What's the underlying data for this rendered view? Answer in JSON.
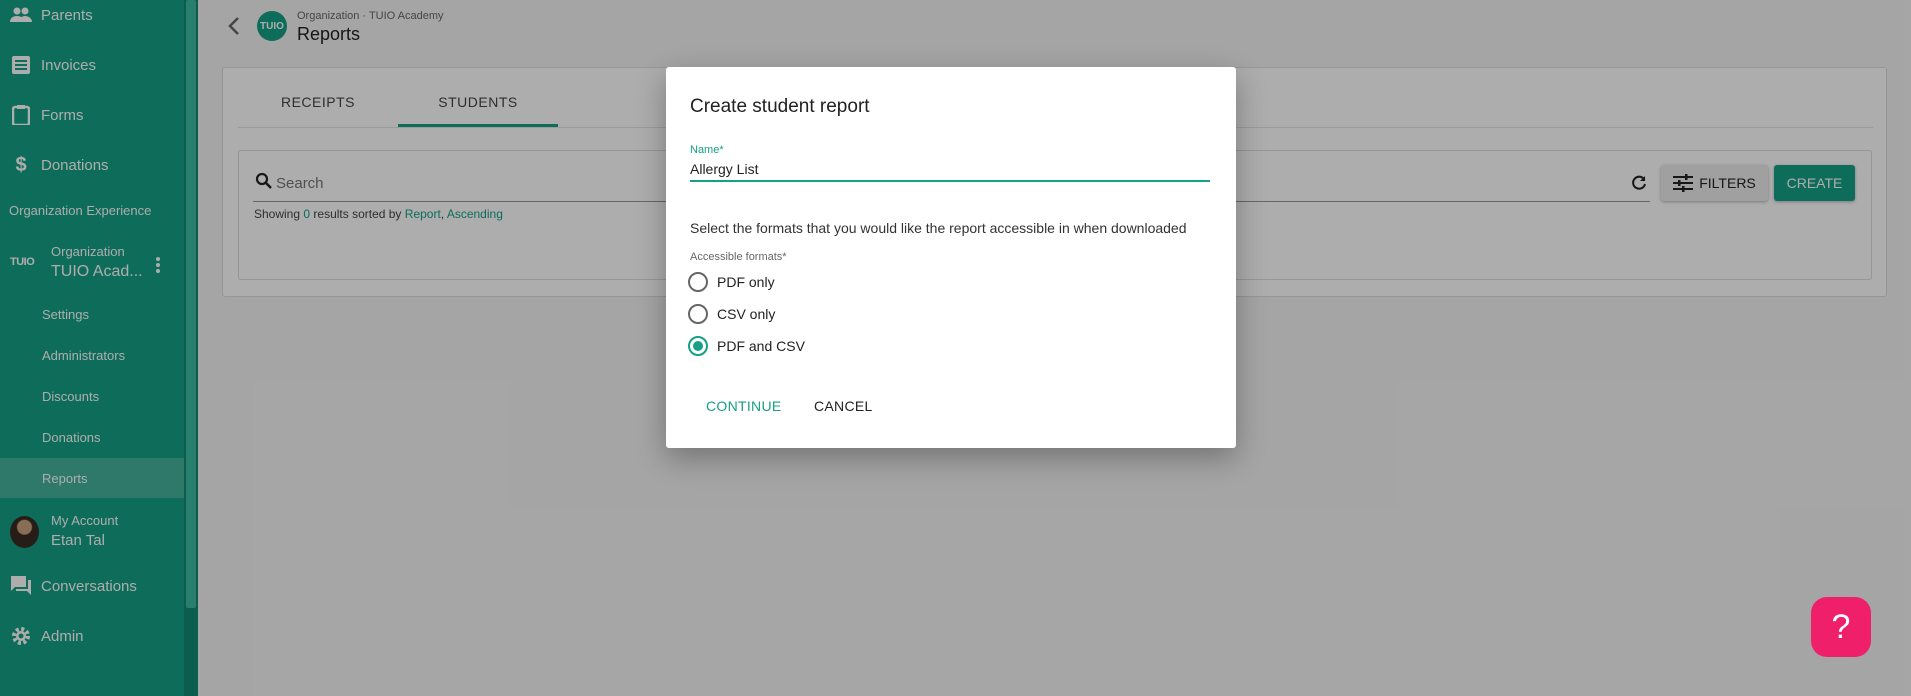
{
  "sidebar": {
    "items_top": [
      {
        "label": "Parents",
        "icon": "people-icon"
      },
      {
        "label": "Invoices",
        "icon": "list-icon"
      },
      {
        "label": "Forms",
        "icon": "clipboard-icon"
      },
      {
        "label": "Donations",
        "icon": "dollar-icon"
      }
    ],
    "section_label": "Organization Experience",
    "org": {
      "logo": "TUIO",
      "small": "Organization",
      "name": "TUIO Acad..."
    },
    "sub_items": [
      {
        "label": "Settings"
      },
      {
        "label": "Administrators"
      },
      {
        "label": "Discounts"
      },
      {
        "label": "Donations"
      },
      {
        "label": "Reports"
      }
    ],
    "account": {
      "small": "My Account",
      "name": "Etan Tal"
    },
    "items_bottom": [
      {
        "label": "Conversations",
        "icon": "chat-icon"
      },
      {
        "label": "Admin",
        "icon": "gear-icon"
      }
    ]
  },
  "header": {
    "logo": "TUIO",
    "breadcrumb": "Organization · TUIO Academy",
    "title": "Reports"
  },
  "tabs": [
    {
      "label": "RECEIPTS"
    },
    {
      "label": "STUDENTS",
      "active": true
    }
  ],
  "search": {
    "placeholder": "Search"
  },
  "status": {
    "prefix": "Showing ",
    "count": "0",
    "middle": " results sorted by ",
    "sort_field": "Report",
    "sep": ", ",
    "sort_dir": "Ascending"
  },
  "toolbar": {
    "filters_label": "FILTERS",
    "create_label": "CREATE"
  },
  "dialog": {
    "title": "Create student report",
    "name_label": "Name*",
    "name_value": "Allergy List",
    "description": "Select the formats that you would like the report accessible in when downloaded",
    "formats_label": "Accessible formats*",
    "options": [
      {
        "label": "PDF only",
        "checked": false
      },
      {
        "label": "CSV only",
        "checked": false
      },
      {
        "label": "PDF and CSV",
        "checked": true
      }
    ],
    "continue_label": "CONTINUE",
    "cancel_label": "CANCEL"
  },
  "help": {
    "label": "?"
  },
  "colors": {
    "brand": "#16a085",
    "help": "#ef1f6a"
  }
}
